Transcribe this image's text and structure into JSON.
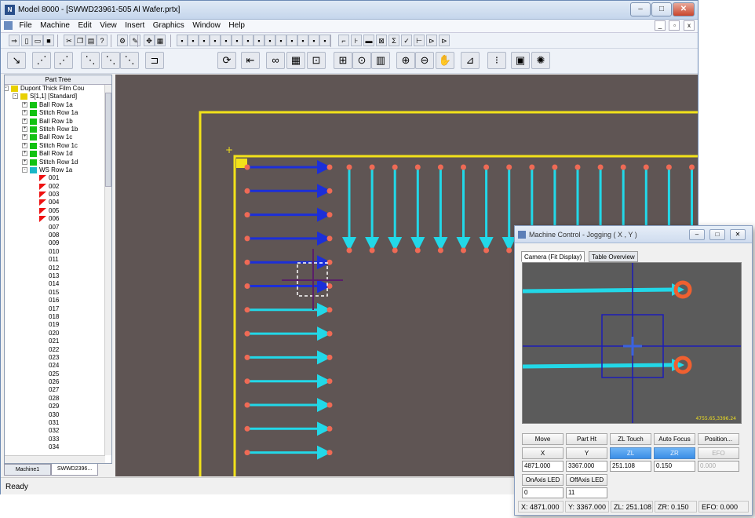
{
  "window": {
    "title": "Model 8000 - [SWWD23961-505 Al Wafer.prtx]",
    "app_icon": "N",
    "minimize": "–",
    "maximize": "□",
    "close": "✕"
  },
  "menu": [
    "File",
    "Machine",
    "Edit",
    "View",
    "Insert",
    "Graphics",
    "Window",
    "Help"
  ],
  "mdi": {
    "min": "_",
    "restore": "▫",
    "close": "x"
  },
  "toolbar1": [
    {
      "name": "arrow-tool-icon",
      "g": "⇒"
    },
    {
      "name": "new-file-icon",
      "g": "▯"
    },
    {
      "name": "open-file-icon",
      "g": "▭"
    },
    {
      "name": "save-icon",
      "g": "■"
    },
    {
      "name": "cut-icon",
      "g": "✂"
    },
    {
      "name": "copy-icon",
      "g": "❐"
    },
    {
      "name": "paste-icon",
      "g": "▤"
    },
    {
      "name": "help-icon",
      "g": "?"
    },
    {
      "name": "settings-icon",
      "g": "⚙"
    },
    {
      "name": "pen-icon",
      "g": "✎"
    },
    {
      "name": "move-icon",
      "g": "✥"
    },
    {
      "name": "grid-icon",
      "g": "▦"
    },
    {
      "name": "shape-1-icon",
      "g": "▪"
    },
    {
      "name": "shape-2-icon",
      "g": "▪"
    },
    {
      "name": "shape-3-icon",
      "g": "▪"
    },
    {
      "name": "shape-4-icon",
      "g": "▪"
    },
    {
      "name": "shape-5-icon",
      "g": "▪"
    },
    {
      "name": "shape-6-icon",
      "g": "▪"
    },
    {
      "name": "shape-7-icon",
      "g": "▪"
    },
    {
      "name": "shape-8-icon",
      "g": "▪"
    },
    {
      "name": "shape-9-icon",
      "g": "▪"
    },
    {
      "name": "shape-10-icon",
      "g": "▪"
    },
    {
      "name": "shape-11-icon",
      "g": "▪"
    },
    {
      "name": "shape-12-icon",
      "g": "▪"
    },
    {
      "name": "shape-13-icon",
      "g": "▪"
    },
    {
      "name": "shape-14-icon",
      "g": "▪"
    },
    {
      "name": "wire-icon",
      "g": "⌐"
    },
    {
      "name": "tree-icon",
      "g": "⊦"
    },
    {
      "name": "measure-icon",
      "g": "▬"
    },
    {
      "name": "chart-icon",
      "g": "⊠"
    },
    {
      "name": "sum-icon",
      "g": "Σ"
    },
    {
      "name": "check-icon",
      "g": "✓"
    },
    {
      "name": "step-1-icon",
      "g": "⊢"
    },
    {
      "name": "step-2-icon",
      "g": "⊳"
    },
    {
      "name": "step-3-icon",
      "g": "⊳"
    }
  ],
  "toolbar2": [
    {
      "name": "jog-icon",
      "g": "↘"
    },
    {
      "name": "bond-1-icon",
      "g": "⋰"
    },
    {
      "name": "bond-2-icon",
      "g": "⋰"
    },
    {
      "name": "bond-3-icon",
      "g": "⋱"
    },
    {
      "name": "bond-4-icon",
      "g": "⋱"
    },
    {
      "name": "bond-5-icon",
      "g": "⋱"
    },
    {
      "name": "bond-6-icon",
      "g": "⊐"
    },
    {
      "name": "refresh-icon",
      "g": "⟳"
    },
    {
      "name": "rewind-icon",
      "g": "⇤"
    },
    {
      "name": "link-icon",
      "g": "∞"
    },
    {
      "name": "red-grid-icon",
      "g": "▦"
    },
    {
      "name": "fit-view-icon",
      "g": "⊡"
    },
    {
      "name": "zoom-window-icon",
      "g": "⊞"
    },
    {
      "name": "view-center-icon",
      "g": "⊙"
    },
    {
      "name": "table-view-icon",
      "g": "▥"
    },
    {
      "name": "zoom-in-icon",
      "g": "⊕"
    },
    {
      "name": "zoom-out-icon",
      "g": "⊖"
    },
    {
      "name": "pan-hand-icon",
      "g": "✋"
    },
    {
      "name": "calibrate-icon",
      "g": "⊿"
    },
    {
      "name": "traffic-light-icon",
      "g": "⁝"
    },
    {
      "name": "lock-icon",
      "g": "▣"
    },
    {
      "name": "wheel-icon",
      "g": "✺"
    }
  ],
  "part_tree": {
    "title": "Part Tree",
    "rows": [
      {
        "label": "Dupont Thick Film Cou",
        "level": 0,
        "exp": "-",
        "icon": "#e8d000"
      },
      {
        "label": "S[1,1] [Standard]",
        "level": 1,
        "exp": "-",
        "icon": "#e8d000"
      },
      {
        "label": "Ball Row 1a",
        "level": 2,
        "exp": "+",
        "icon": "#12c212"
      },
      {
        "label": "Stitch Row 1a",
        "level": 2,
        "exp": "+",
        "icon": "#12c212"
      },
      {
        "label": "Ball Row 1b",
        "level": 2,
        "exp": "+",
        "icon": "#12c212"
      },
      {
        "label": "Stitch Row 1b",
        "level": 2,
        "exp": "+",
        "icon": "#12c212"
      },
      {
        "label": "Ball Row 1c",
        "level": 2,
        "exp": "+",
        "icon": "#12c212"
      },
      {
        "label": "Stitch Row 1c",
        "level": 2,
        "exp": "+",
        "icon": "#12c212"
      },
      {
        "label": "Ball Row 1d",
        "level": 2,
        "exp": "+",
        "icon": "#12c212"
      },
      {
        "label": "Stitch Row 1d",
        "level": 2,
        "exp": "+",
        "icon": "#12c212"
      },
      {
        "label": "WS Row 1a",
        "level": 2,
        "exp": "-",
        "icon": "#1ab8c8"
      },
      {
        "label": "001",
        "level": 3,
        "icon": "red"
      },
      {
        "label": "002",
        "level": 3,
        "icon": "red"
      },
      {
        "label": "003",
        "level": 3,
        "icon": "red"
      },
      {
        "label": "004",
        "level": 3,
        "icon": "red"
      },
      {
        "label": "005",
        "level": 3,
        "icon": "red"
      },
      {
        "label": "006",
        "level": 3,
        "icon": "red"
      },
      {
        "label": "007",
        "level": 3
      },
      {
        "label": "008",
        "level": 3
      },
      {
        "label": "009",
        "level": 3
      },
      {
        "label": "010",
        "level": 3
      },
      {
        "label": "011",
        "level": 3
      },
      {
        "label": "012",
        "level": 3
      },
      {
        "label": "013",
        "level": 3
      },
      {
        "label": "014",
        "level": 3
      },
      {
        "label": "015",
        "level": 3
      },
      {
        "label": "016",
        "level": 3
      },
      {
        "label": "017",
        "level": 3
      },
      {
        "label": "018",
        "level": 3
      },
      {
        "label": "019",
        "level": 3
      },
      {
        "label": "020",
        "level": 3
      },
      {
        "label": "021",
        "level": 3
      },
      {
        "label": "022",
        "level": 3
      },
      {
        "label": "023",
        "level": 3
      },
      {
        "label": "024",
        "level": 3
      },
      {
        "label": "025",
        "level": 3
      },
      {
        "label": "026",
        "level": 3
      },
      {
        "label": "027",
        "level": 3
      },
      {
        "label": "028",
        "level": 3
      },
      {
        "label": "029",
        "level": 3
      },
      {
        "label": "030",
        "level": 3
      },
      {
        "label": "031",
        "level": 3
      },
      {
        "label": "032",
        "level": 3
      },
      {
        "label": "033",
        "level": 3
      },
      {
        "label": "034",
        "level": 3
      }
    ]
  },
  "bottom_tabs": [
    "Machine1",
    "SWWD2396..."
  ],
  "status": "Ready",
  "machine_control": {
    "title": "Machine Control - Jogging ( X , Y )",
    "minimize": "–",
    "restore": "□",
    "close": "✕",
    "tabs": [
      "Camera (Fit Display)",
      "Table Overview"
    ],
    "camera_readout": "4755.65,3396.24",
    "buttons": [
      "Move",
      "Part Ht",
      "ZL Touch",
      "Auto Focus",
      "Position..."
    ],
    "axes": [
      "X",
      "Y",
      "ZL",
      "ZR",
      "EFO"
    ],
    "values": [
      "4871.000",
      "3367.000",
      "251.108",
      "0.150",
      "0.000"
    ],
    "led_labels": [
      "OnAxis LED",
      "OffAxis LED"
    ],
    "led_values": [
      "0",
      "11"
    ],
    "status": [
      "X: 4871.000",
      "Y: 3367.000",
      "ZL: 251.108",
      "ZR: 0.150",
      "EFO: 0.000"
    ]
  },
  "colors": {
    "canvas": "#5f5554",
    "outline": "#f2e21a",
    "stitch": "#22d8e8",
    "ball": "#1c2fd8",
    "pad": "#ef6a55",
    "crosshair": "#5a1e6a"
  }
}
